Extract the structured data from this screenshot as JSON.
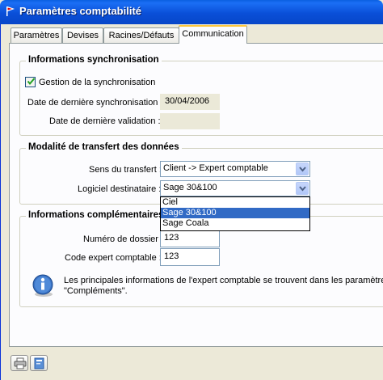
{
  "window": {
    "title": "Paramètres comptabilité"
  },
  "tabs": [
    {
      "label": "Paramètres",
      "active": false
    },
    {
      "label": "Devises",
      "active": false
    },
    {
      "label": "Racines/Défauts",
      "active": false
    },
    {
      "label": "Communication",
      "active": true
    }
  ],
  "sync": {
    "group_title": "Informations synchronisation",
    "checkbox_label": "Gestion de la synchronisation",
    "checked": true,
    "last_sync_label": "Date de dernière synchronisation :",
    "last_sync_value": "30/04/2006",
    "last_validation_label": "Date de dernière validation :",
    "last_validation_value": ""
  },
  "transfer": {
    "group_title": "Modalité de transfert des données",
    "direction_label": "Sens du transfert :",
    "direction_value": "Client -> Expert comptable",
    "software_label": "Logiciel destinataire :",
    "software_value": "Sage 30&100",
    "software_options": [
      "Ciel",
      "Sage 30&100",
      "Sage Coala"
    ],
    "software_selected_index": 1
  },
  "extra": {
    "group_title": "Informations complémentaires",
    "folder_label": "Numéro de dossier :",
    "folder_value": "123",
    "expert_code_label": "Code expert comptable :",
    "expert_code_value": "123",
    "info_line1": "Les principales informations de l'expert comptable se trouvent dans les paramètres se",
    "info_line2": "\"Compléments\"."
  },
  "colors": {
    "titlebar": "#0a4fd8",
    "selection": "#316ac5",
    "active_tab_accent": "#ffc83c",
    "readonly_field": "#ebe9d8"
  },
  "icons": {
    "title": "app-flag-icon",
    "info": "info-icon",
    "bottom_left": "printer-icon",
    "bottom_left2": "help-icon"
  }
}
